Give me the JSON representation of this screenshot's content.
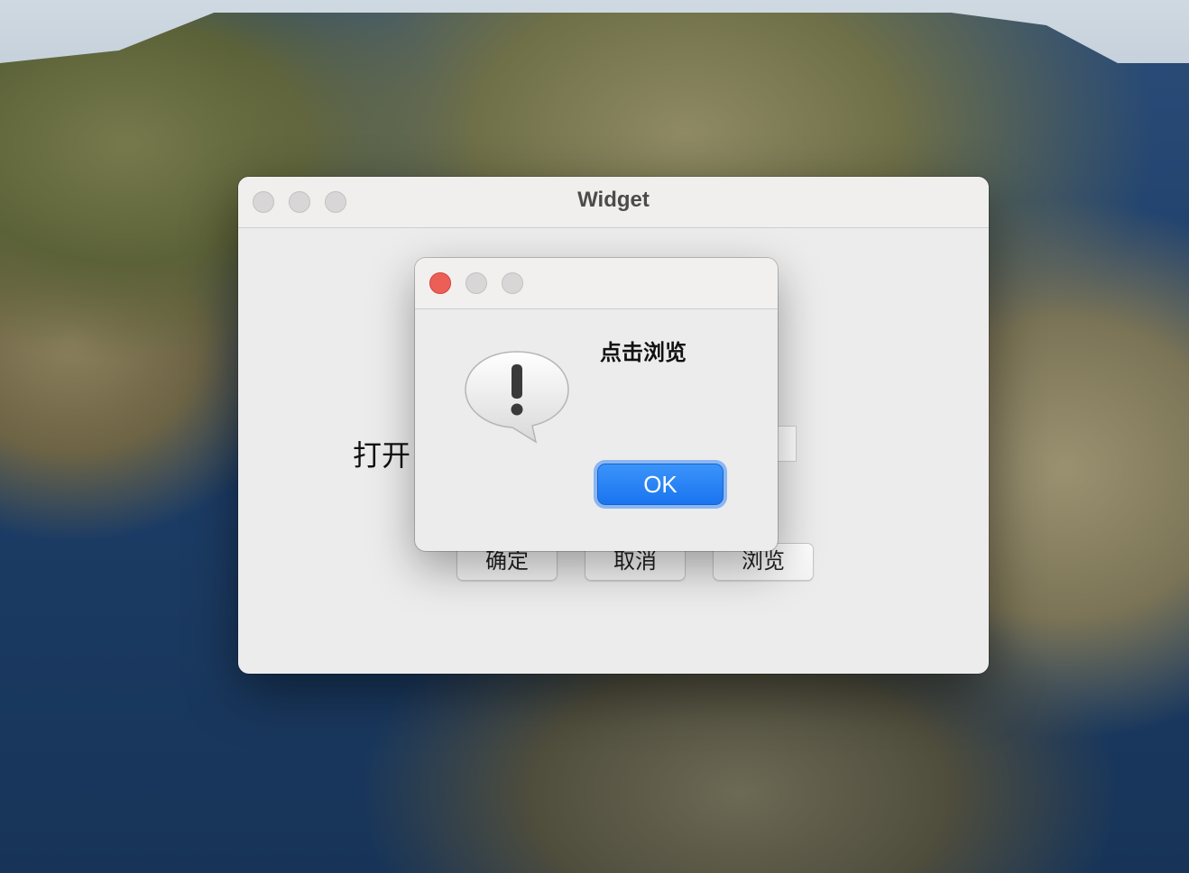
{
  "window": {
    "title": "Widget"
  },
  "main": {
    "open_label": "打开",
    "path_value": "",
    "buttons": {
      "confirm": "确定",
      "cancel": "取消",
      "browse": "浏览"
    }
  },
  "dialog": {
    "message": "点击浏览",
    "ok_label": "OK",
    "icon": "exclamation-speech-bubble-icon"
  },
  "colors": {
    "ok_button": "#1a74ef",
    "close_button": "#ec5f57",
    "window_background": "#ececec"
  }
}
